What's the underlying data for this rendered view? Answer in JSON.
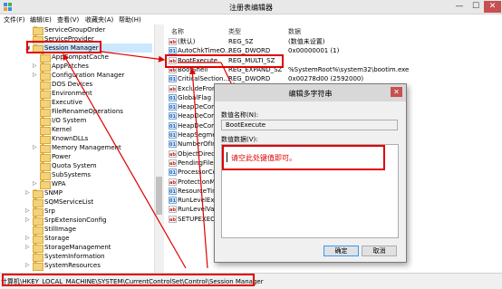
{
  "window": {
    "title": "注册表编辑器",
    "controls": {
      "minimize": "—",
      "maximize": "☐",
      "close": "✕"
    }
  },
  "menu": [
    "文件(F)",
    "编辑(E)",
    "查看(V)",
    "收藏夹(A)",
    "帮助(H)"
  ],
  "tree": {
    "items": [
      {
        "label": "ServiceGroupOrder",
        "level": 0,
        "expander": ""
      },
      {
        "label": "ServiceProvider",
        "level": 0,
        "expander": ""
      },
      {
        "label": "Session Manager",
        "level": 0,
        "expander": "◢",
        "selected": true
      },
      {
        "label": "AppCompatCache",
        "level": 1,
        "expander": ""
      },
      {
        "label": "AppPatches",
        "level": 1,
        "expander": "▷"
      },
      {
        "label": "Configuration Manager",
        "level": 1,
        "expander": "▷"
      },
      {
        "label": "DOS Devices",
        "level": 1,
        "expander": ""
      },
      {
        "label": "Environment",
        "level": 1,
        "expander": ""
      },
      {
        "label": "Executive",
        "level": 1,
        "expander": ""
      },
      {
        "label": "FileRenameOperations",
        "level": 1,
        "expander": ""
      },
      {
        "label": "I/O System",
        "level": 1,
        "expander": ""
      },
      {
        "label": "Kernel",
        "level": 1,
        "expander": ""
      },
      {
        "label": "KnownDLLs",
        "level": 1,
        "expander": ""
      },
      {
        "label": "Memory Management",
        "level": 1,
        "expander": "▷"
      },
      {
        "label": "Power",
        "level": 1,
        "expander": ""
      },
      {
        "label": "Quota System",
        "level": 1,
        "expander": ""
      },
      {
        "label": "SubSystems",
        "level": 1,
        "expander": ""
      },
      {
        "label": "WPA",
        "level": 1,
        "expander": "▷"
      },
      {
        "label": "SNMP",
        "level": 0,
        "expander": "▷"
      },
      {
        "label": "SQMServiceList",
        "level": 0,
        "expander": ""
      },
      {
        "label": "Srp",
        "level": 0,
        "expander": "▷"
      },
      {
        "label": "SrpExtensionConfig",
        "level": 0,
        "expander": "▷"
      },
      {
        "label": "StillImage",
        "level": 0,
        "expander": ""
      },
      {
        "label": "Storage",
        "level": 0,
        "expander": "▷"
      },
      {
        "label": "StorageManagement",
        "level": 0,
        "expander": "▷"
      },
      {
        "label": "SystemInformation",
        "level": 0,
        "expander": ""
      },
      {
        "label": "SystemResources",
        "level": 0,
        "expander": "▷"
      }
    ]
  },
  "list": {
    "headers": {
      "name": "名称",
      "type": "类型",
      "data": "数据"
    },
    "rows": [
      {
        "icon": "string-value-icon",
        "glyph": "ab",
        "name": "(默认)",
        "type": "REG_SZ",
        "data": "(数值未设置)"
      },
      {
        "icon": "binary-value-icon",
        "glyph": "01",
        "name": "AutoChkTimeO...",
        "type": "REG_DWORD",
        "data": "0x00000001 (1)"
      },
      {
        "icon": "string-value-icon",
        "glyph": "ab",
        "name": "BootExecute",
        "type": "REG_MULTI_SZ",
        "data": ""
      },
      {
        "icon": "string-value-icon",
        "glyph": "ab",
        "name": "BootShell",
        "type": "REG_EXPAND_SZ",
        "data": "%SystemRoot%\\system32\\bootim.exe"
      },
      {
        "icon": "binary-value-icon",
        "glyph": "01",
        "name": "CriticalSection...",
        "type": "REG_DWORD",
        "data": "0x00278d00 (2592000)"
      },
      {
        "icon": "string-value-icon",
        "glyph": "ab",
        "name": "ExcludeFrom",
        "type": "",
        "data": ""
      },
      {
        "icon": "binary-value-icon",
        "glyph": "01",
        "name": "GlobalFlag",
        "type": "",
        "data": ""
      },
      {
        "icon": "binary-value-icon",
        "glyph": "01",
        "name": "HeapDeCom",
        "type": "",
        "data": ""
      },
      {
        "icon": "binary-value-icon",
        "glyph": "01",
        "name": "HeapDeCom",
        "type": "",
        "data": ""
      },
      {
        "icon": "binary-value-icon",
        "glyph": "01",
        "name": "HeapDeCom",
        "type": "",
        "data": ""
      },
      {
        "icon": "binary-value-icon",
        "glyph": "01",
        "name": "HeapSegme",
        "type": "",
        "data": ""
      },
      {
        "icon": "binary-value-icon",
        "glyph": "01",
        "name": "NumberOfIn",
        "type": "",
        "data": ""
      },
      {
        "icon": "string-value-icon",
        "glyph": "ab",
        "name": "ObjectDirec",
        "type": "",
        "data": ""
      },
      {
        "icon": "string-value-icon",
        "glyph": "ab",
        "name": "PendingFile",
        "type": "",
        "data": ""
      },
      {
        "icon": "binary-value-icon",
        "glyph": "01",
        "name": "ProcessorCo",
        "type": "",
        "data": ""
      },
      {
        "icon": "string-value-icon",
        "glyph": "ab",
        "name": "ProtectionM",
        "type": "",
        "data": ""
      },
      {
        "icon": "binary-value-icon",
        "glyph": "01",
        "name": "ResourceTim",
        "type": "",
        "data": ""
      },
      {
        "icon": "binary-value-icon",
        "glyph": "01",
        "name": "RunLevelExe",
        "type": "",
        "data": ""
      },
      {
        "icon": "string-value-icon",
        "glyph": "ab",
        "name": "RunLevelVali",
        "type": "",
        "data": ""
      },
      {
        "icon": "string-value-icon",
        "glyph": "ab",
        "name": "SETUPEXECL",
        "type": "",
        "data": ""
      }
    ]
  },
  "status": {
    "path": "计算机\\HKEY_LOCAL_MACHINE\\SYSTEM\\CurrentControlSet\\Control\\Session Manager"
  },
  "dialog": {
    "title": "编辑多字符串",
    "close": "✕",
    "name_label": "数值名称(N):",
    "name_value": "BootExecute",
    "data_label": "数值数据(V):",
    "hint": "请空此处键值即可。",
    "ok": "确定",
    "cancel": "取消"
  },
  "colors": {
    "annotation": "#e00000",
    "selection": "#cce8ff",
    "close_button": "#c75050"
  }
}
